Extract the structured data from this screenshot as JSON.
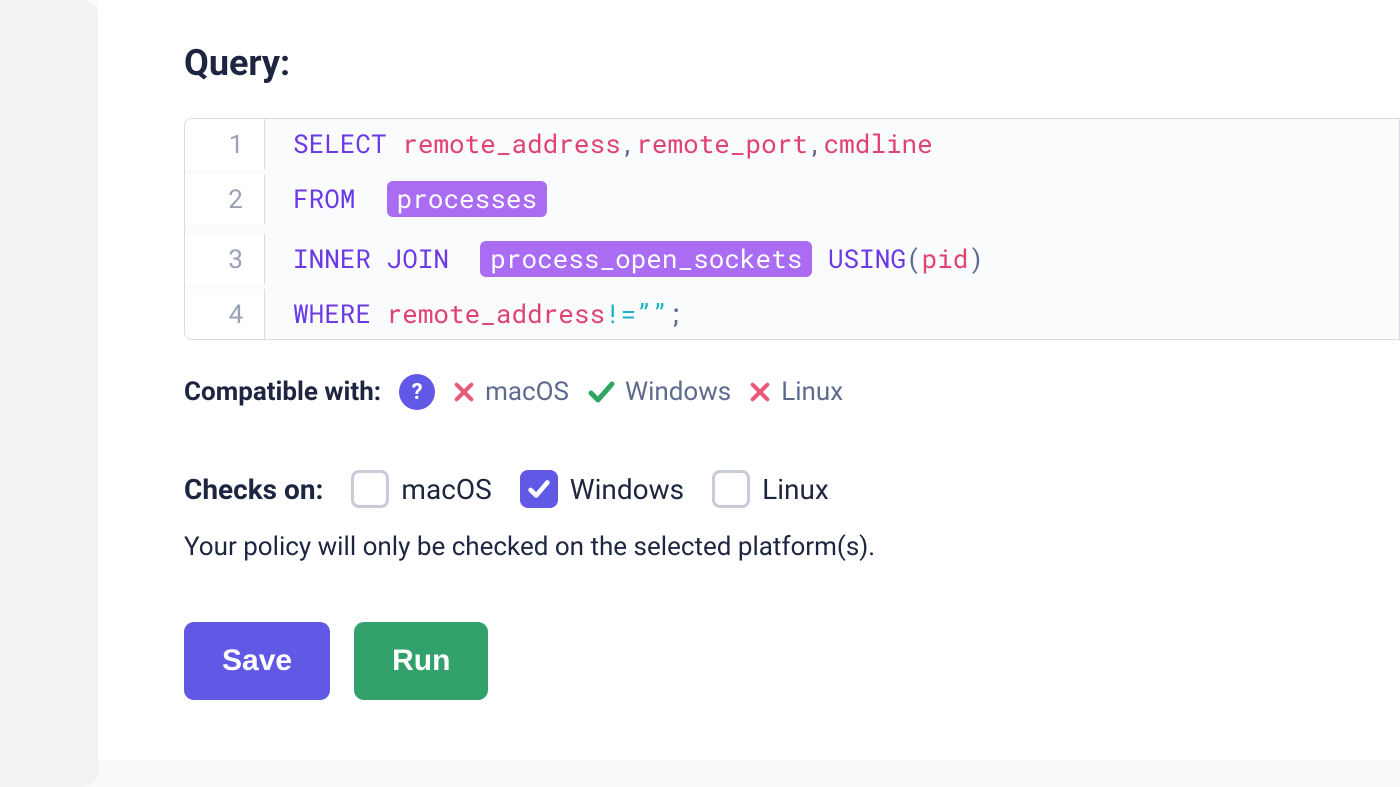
{
  "section": {
    "title": "Query:"
  },
  "editor": {
    "lines": [
      "1",
      "2",
      "3",
      "4"
    ],
    "code": {
      "l1": {
        "kw": "SELECT",
        "idents": [
          "remote_address",
          "remote_port",
          "cmdline"
        ]
      },
      "l2": {
        "kw": "FROM",
        "table": "processes"
      },
      "l3": {
        "kw1": "INNER",
        "kw2": "JOIN",
        "table": "process_open_sockets",
        "kw3": "USING",
        "ident": "pid"
      },
      "l4": {
        "kw": "WHERE",
        "ident": "remote_address",
        "op": "!=",
        "str": "””",
        "term": ";"
      }
    }
  },
  "compat": {
    "label": "Compatible with:",
    "help": "?",
    "items": [
      {
        "name": "macOS",
        "ok": false
      },
      {
        "name": "Windows",
        "ok": true
      },
      {
        "name": "Linux",
        "ok": false
      }
    ]
  },
  "checks": {
    "label": "Checks on:",
    "options": [
      {
        "name": "macOS",
        "checked": false
      },
      {
        "name": "Windows",
        "checked": true
      },
      {
        "name": "Linux",
        "checked": false
      }
    ],
    "helper": "Your policy will only be checked on the selected platform(s)."
  },
  "buttons": {
    "save": "Save",
    "run": "Run"
  }
}
